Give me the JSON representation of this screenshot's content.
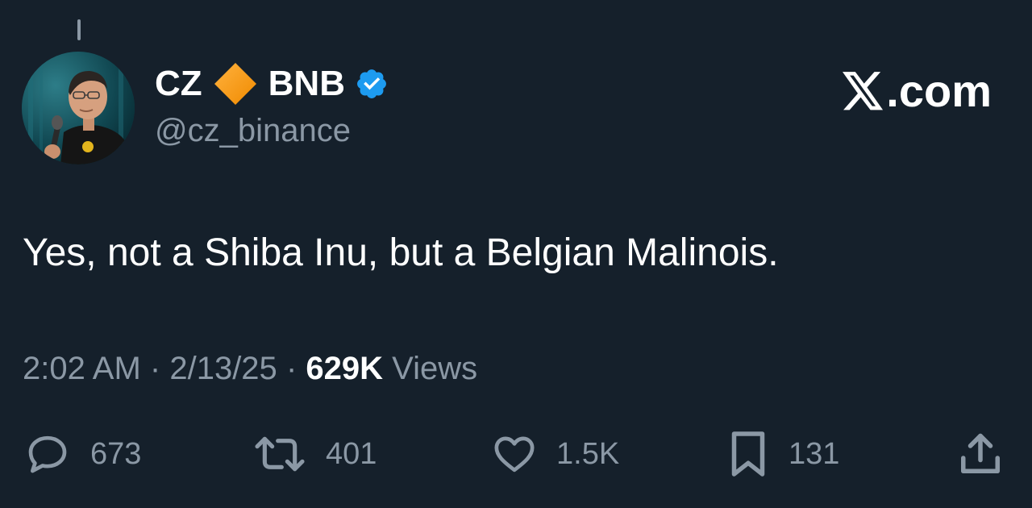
{
  "author": {
    "name_prefix": "CZ",
    "name_suffix": "BNB",
    "handle": "@cz_binance",
    "avatar_alt": "Profile photo of CZ"
  },
  "brand": {
    "domain_suffix": ".com",
    "icon": "x-logo-icon"
  },
  "tweet": {
    "text": "Yes, not a Shiba Inu, but a Belgian Malinois."
  },
  "meta": {
    "time": "2:02 AM",
    "separator": "·",
    "date": "2/13/25",
    "views_count": "629K",
    "views_label": "Views"
  },
  "actions": {
    "replies": "673",
    "reposts": "401",
    "likes": "1.5K",
    "bookmarks": "131"
  },
  "icons": {
    "diamond": "orange-diamond-icon",
    "verified": "verified-badge-icon",
    "reply": "reply-icon",
    "repost": "repost-icon",
    "like": "heart-icon",
    "bookmark": "bookmark-icon",
    "share": "share-icon"
  },
  "colors": {
    "background": "#15202b",
    "text": "#ffffff",
    "secondary": "#8b98a5",
    "verified": "#1d9bf0",
    "diamond": "#f7931a"
  }
}
